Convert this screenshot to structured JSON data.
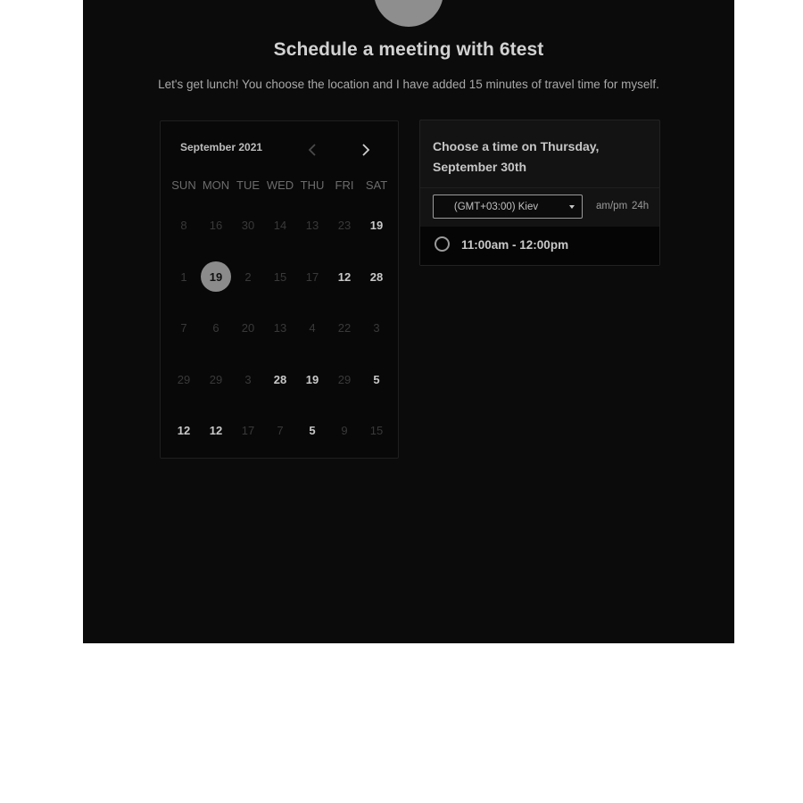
{
  "page": {
    "title": "Schedule a meeting with 6test",
    "subtitle": "Let's get lunch! You choose the location and I have added 15 minutes of travel time for myself."
  },
  "calendar": {
    "month_label": "September 2021",
    "prev_icon": "chevron-left-icon",
    "next_icon": "chevron-right-icon",
    "weekdays": [
      "SUN",
      "MON",
      "TUE",
      "WED",
      "THU",
      "FRI",
      "SAT"
    ],
    "weeks": [
      [
        {
          "d": "8",
          "s": "muted"
        },
        {
          "d": "16",
          "s": "muted"
        },
        {
          "d": "30",
          "s": "muted"
        },
        {
          "d": "14",
          "s": "muted"
        },
        {
          "d": "13",
          "s": "muted"
        },
        {
          "d": "23",
          "s": "muted"
        },
        {
          "d": "19",
          "s": "available"
        }
      ],
      [
        {
          "d": "1",
          "s": "muted"
        },
        {
          "d": "19",
          "s": "selected"
        },
        {
          "d": "2",
          "s": "muted"
        },
        {
          "d": "15",
          "s": "muted"
        },
        {
          "d": "17",
          "s": "muted"
        },
        {
          "d": "12",
          "s": "available"
        },
        {
          "d": "28",
          "s": "available"
        }
      ],
      [
        {
          "d": "7",
          "s": "muted"
        },
        {
          "d": "6",
          "s": "muted"
        },
        {
          "d": "20",
          "s": "muted"
        },
        {
          "d": "13",
          "s": "muted"
        },
        {
          "d": "4",
          "s": "muted"
        },
        {
          "d": "22",
          "s": "muted"
        },
        {
          "d": "3",
          "s": "muted"
        }
      ],
      [
        {
          "d": "29",
          "s": "muted"
        },
        {
          "d": "29",
          "s": "muted"
        },
        {
          "d": "3",
          "s": "muted"
        },
        {
          "d": "28",
          "s": "available"
        },
        {
          "d": "19",
          "s": "available"
        },
        {
          "d": "29",
          "s": "muted"
        },
        {
          "d": "5",
          "s": "available"
        }
      ],
      [
        {
          "d": "12",
          "s": "available"
        },
        {
          "d": "12",
          "s": "available"
        },
        {
          "d": "17",
          "s": "muted"
        },
        {
          "d": "7",
          "s": "muted"
        },
        {
          "d": "5",
          "s": "available"
        },
        {
          "d": "9",
          "s": "muted"
        },
        {
          "d": "15",
          "s": "muted"
        }
      ]
    ]
  },
  "time_panel": {
    "title": "Choose a time on Thursday, September 30th",
    "timezone": "(GMT+03:00) Kiev",
    "format_ampm": "am/pm",
    "format_24h": "24h",
    "slots": [
      "11:00am - 12:00pm"
    ]
  },
  "colors": {
    "background": "#0b0b0b",
    "selected_day": "#8b8b8b",
    "text": "#c8c8c8"
  }
}
